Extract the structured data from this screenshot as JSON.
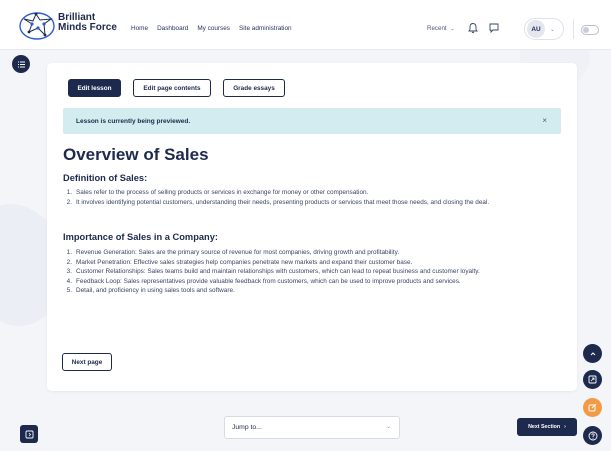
{
  "header": {
    "brand_line1": "Brilliant",
    "brand_line2": "Minds Force",
    "brand_tagline": "",
    "nav": [
      "Home",
      "Dashboard",
      "My courses",
      "Site administration"
    ],
    "recent_label": "Recent",
    "avatar_initials": "AU"
  },
  "toolbar": {
    "edit_lesson": "Edit lesson",
    "edit_page_contents": "Edit page contents",
    "grade_essays": "Grade essays"
  },
  "alert": {
    "text": "Lesson is currently being previewed.",
    "close": "×"
  },
  "content": {
    "title": "Overview of Sales",
    "section1": {
      "heading": "Definition of Sales:",
      "items": [
        "Sales refer to the process of selling products or services in exchange for money or other compensation.",
        "It involves identifying potential customers, understanding their needs, presenting products or services that meet those needs, and closing the deal."
      ]
    },
    "section2": {
      "heading": "Importance of Sales in a Company:",
      "items": [
        "Revenue Generation: Sales are the primary source of revenue for most companies, driving growth and profitability.",
        "Market Penetration: Effective sales strategies help companies penetrate new markets and expand their customer base.",
        "Customer Relationships: Sales teams build and maintain relationships with customers, which can lead to repeat business and customer loyalty.",
        "Feedback Loop: Sales representatives provide valuable feedback from customers, which can be used to improve products and services.",
        "Detail, and proficiency in using sales tools and software."
      ]
    },
    "next_page": "Next page"
  },
  "footer": {
    "jump_placeholder": "Jump to...",
    "next_section": "Next Section"
  },
  "colors": {
    "primary": "#1d2a4d",
    "alert_bg": "#d3ecef",
    "accent_orange": "#f39a45",
    "background": "#f4f5f9"
  },
  "icons": [
    "menu-icon",
    "bell-icon",
    "chat-icon",
    "chevron-down-icon",
    "chevron-up-icon",
    "fullscreen-icon",
    "edit-icon",
    "help-icon",
    "sidebar-toggle-icon",
    "chevron-right-icon"
  ]
}
